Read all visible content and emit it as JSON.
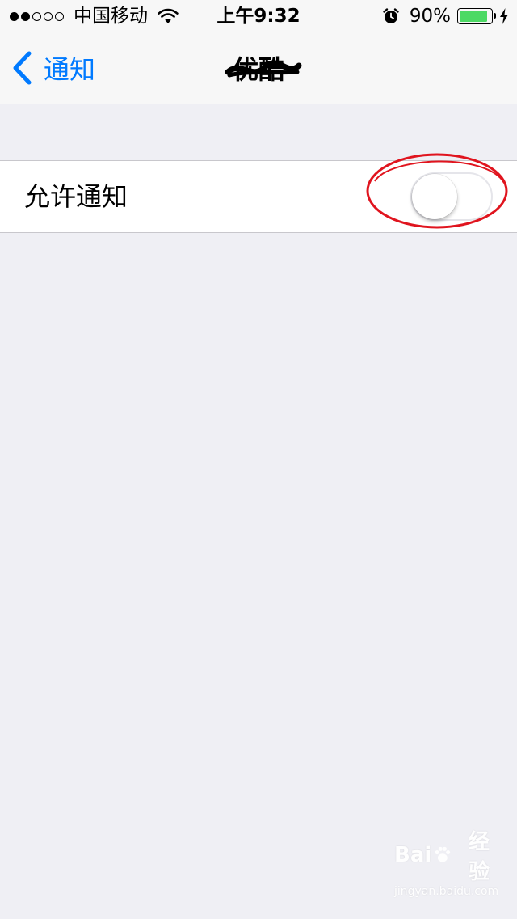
{
  "status_bar": {
    "carrier": "中国移动",
    "time": "上午9:32",
    "battery_percent": "90%",
    "battery_level": 0.9,
    "signal_strength": 2,
    "signal_max": 5,
    "icons": [
      "wifi-icon",
      "alarm-icon",
      "battery-icon",
      "charging-bolt-icon"
    ]
  },
  "nav": {
    "back_label": "通知",
    "back_icon": "chevron-left-icon",
    "title": "优酷",
    "accent_color": "#007aff"
  },
  "settings": {
    "allow_notifications": {
      "label": "允许通知",
      "enabled": false
    }
  },
  "annotation": {
    "color": "#e0141e"
  },
  "watermark": {
    "brand_left": "Bai",
    "brand_right": "经验",
    "url": "jingyan.baidu.com"
  }
}
